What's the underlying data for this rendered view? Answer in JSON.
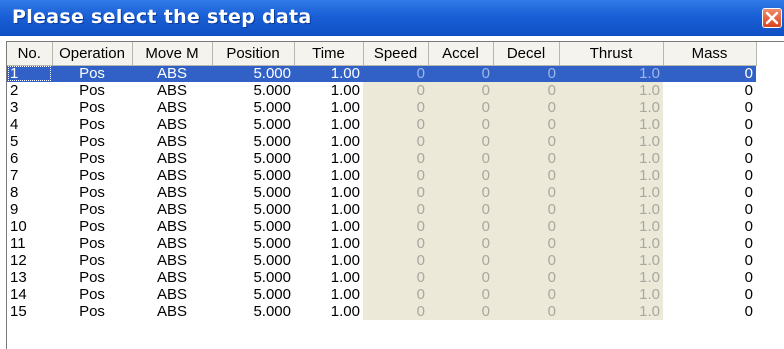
{
  "window": {
    "title": "Please select the step data",
    "accent": "#1a5fd6",
    "close_icon": "close-icon"
  },
  "table": {
    "columns": [
      "No.",
      "Operation",
      "Move M",
      "Position",
      "Time",
      "Speed",
      "Accel",
      "Decel",
      "Thrust",
      "Mass"
    ],
    "selected_row": "1",
    "rows": [
      [
        "1",
        "Pos",
        "ABS",
        "5.000",
        "1.00",
        "0",
        "0",
        "0",
        "1.0",
        "0"
      ],
      [
        "2",
        "Pos",
        "ABS",
        "5.000",
        "1.00",
        "0",
        "0",
        "0",
        "1.0",
        "0"
      ],
      [
        "3",
        "Pos",
        "ABS",
        "5.000",
        "1.00",
        "0",
        "0",
        "0",
        "1.0",
        "0"
      ],
      [
        "4",
        "Pos",
        "ABS",
        "5.000",
        "1.00",
        "0",
        "0",
        "0",
        "1.0",
        "0"
      ],
      [
        "5",
        "Pos",
        "ABS",
        "5.000",
        "1.00",
        "0",
        "0",
        "0",
        "1.0",
        "0"
      ],
      [
        "6",
        "Pos",
        "ABS",
        "5.000",
        "1.00",
        "0",
        "0",
        "0",
        "1.0",
        "0"
      ],
      [
        "7",
        "Pos",
        "ABS",
        "5.000",
        "1.00",
        "0",
        "0",
        "0",
        "1.0",
        "0"
      ],
      [
        "8",
        "Pos",
        "ABS",
        "5.000",
        "1.00",
        "0",
        "0",
        "0",
        "1.0",
        "0"
      ],
      [
        "9",
        "Pos",
        "ABS",
        "5.000",
        "1.00",
        "0",
        "0",
        "0",
        "1.0",
        "0"
      ],
      [
        "10",
        "Pos",
        "ABS",
        "5.000",
        "1.00",
        "0",
        "0",
        "0",
        "1.0",
        "0"
      ],
      [
        "11",
        "Pos",
        "ABS",
        "5.000",
        "1.00",
        "0",
        "0",
        "0",
        "1.0",
        "0"
      ],
      [
        "12",
        "Pos",
        "ABS",
        "5.000",
        "1.00",
        "0",
        "0",
        "0",
        "1.0",
        "0"
      ],
      [
        "13",
        "Pos",
        "ABS",
        "5.000",
        "1.00",
        "0",
        "0",
        "0",
        "1.0",
        "0"
      ],
      [
        "14",
        "Pos",
        "ABS",
        "5.000",
        "1.00",
        "0",
        "0",
        "0",
        "1.0",
        "0"
      ],
      [
        "15",
        "Pos",
        "ABS",
        "5.000",
        "1.00",
        "0",
        "0",
        "0",
        "1.0",
        "0"
      ]
    ]
  }
}
